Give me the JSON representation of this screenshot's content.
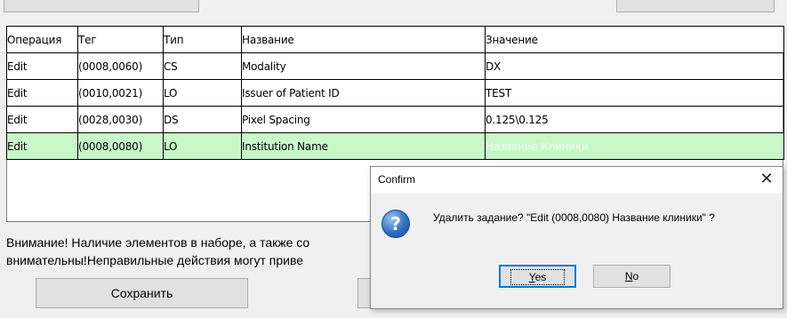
{
  "table": {
    "headers": [
      "Операция",
      "Тег",
      "Тип",
      "Название",
      "Значение"
    ],
    "rows": [
      [
        "Edit",
        "(0008,0060)",
        "CS",
        "Modality",
        "DX"
      ],
      [
        "Edit",
        "(0010,0021)",
        "LO",
        "Issuer of Patient ID",
        "TEST"
      ],
      [
        "Edit",
        "(0028,0030)",
        "DS",
        "Pixel Spacing",
        "0.125\\0.125"
      ],
      [
        "Edit",
        "(0008,0080)",
        "LO",
        "Institution Name",
        "Название Клиники"
      ]
    ]
  },
  "warning": {
    "line1": "Внимание! Наличие элементов в наборе, а также со",
    "line2": "внимательны!Неправильные действия могут приве"
  },
  "buttons": {
    "save_label": "Сохранить"
  },
  "dialog": {
    "title": "Confirm",
    "close_glyph": "✕",
    "icon_glyph": "?",
    "message": "Удалить задание? \"Edit (0008,0080) Название клиники\" ?",
    "yes_mnemonic": "Y",
    "yes_rest": "es",
    "no_mnemonic": "N",
    "no_rest": "o"
  },
  "colors": {
    "selected_row": "#c8f7c8",
    "dialog_focus": "#0078d7"
  }
}
